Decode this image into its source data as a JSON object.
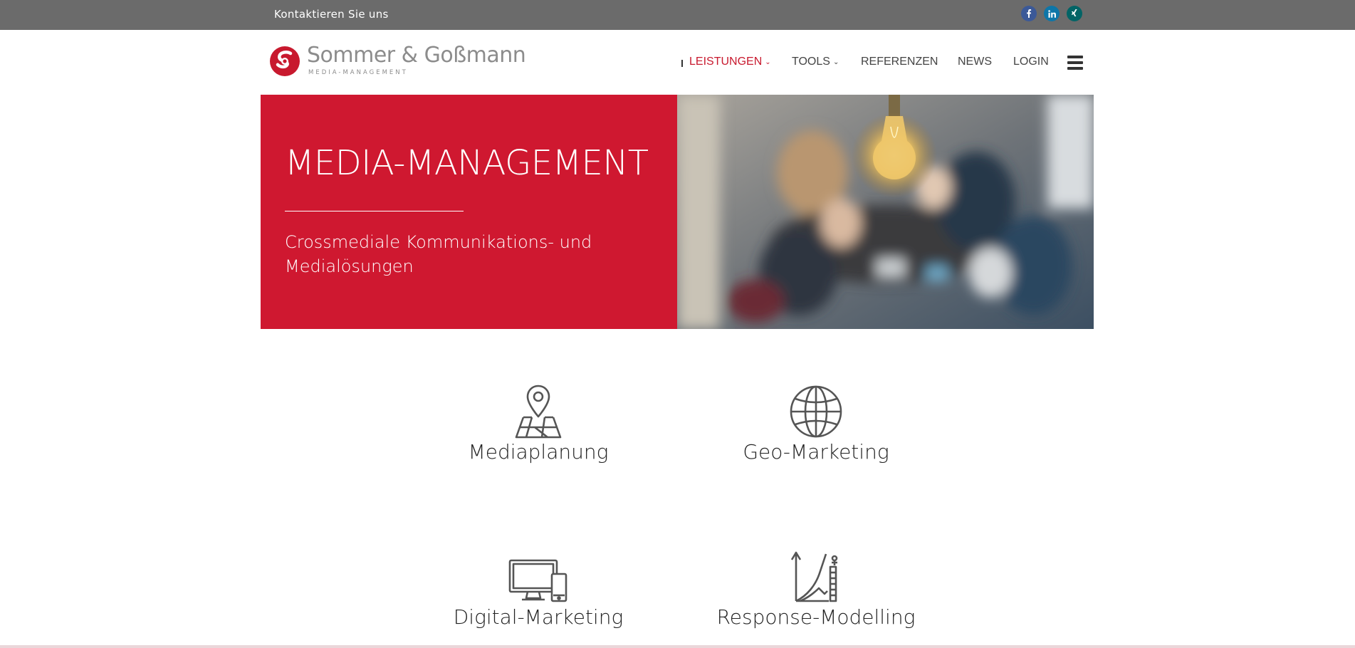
{
  "topbar": {
    "contact": "Kontaktieren Sie uns",
    "social": [
      "facebook-icon",
      "linkedin-icon",
      "xing-icon"
    ]
  },
  "logo": {
    "name": "Sommer & Goßmann",
    "tagline": "MEDIA-MANAGEMENT"
  },
  "nav": {
    "items": [
      {
        "label": "LEISTUNGEN",
        "dropdown": true,
        "active": true
      },
      {
        "label": "TOOLS",
        "dropdown": true,
        "active": false
      },
      {
        "label": "REFERENZEN",
        "dropdown": false,
        "active": false
      },
      {
        "label": "NEWS",
        "dropdown": false,
        "active": false
      },
      {
        "label": "LOGIN",
        "dropdown": false,
        "active": false
      }
    ],
    "menu_icon": "hamburger-icon"
  },
  "hero": {
    "title": "MEDIA-MANAGEMENT",
    "subtitle": "Crossmediale Kommunikations- und Medialösungen"
  },
  "services": [
    {
      "label": "Mediaplanung",
      "icon": "map-pin-icon"
    },
    {
      "label": "Geo-Marketing",
      "icon": "globe-icon"
    },
    {
      "label": "Digital-Marketing",
      "icon": "devices-icon"
    },
    {
      "label": "Response-Modelling",
      "icon": "growth-chart-icon"
    }
  ],
  "colors": {
    "brand_red": "#cf1830",
    "topbar": "#6b6b6b",
    "facebook": "#3b5998",
    "linkedin": "#0e76a8",
    "xing": "#026466"
  }
}
